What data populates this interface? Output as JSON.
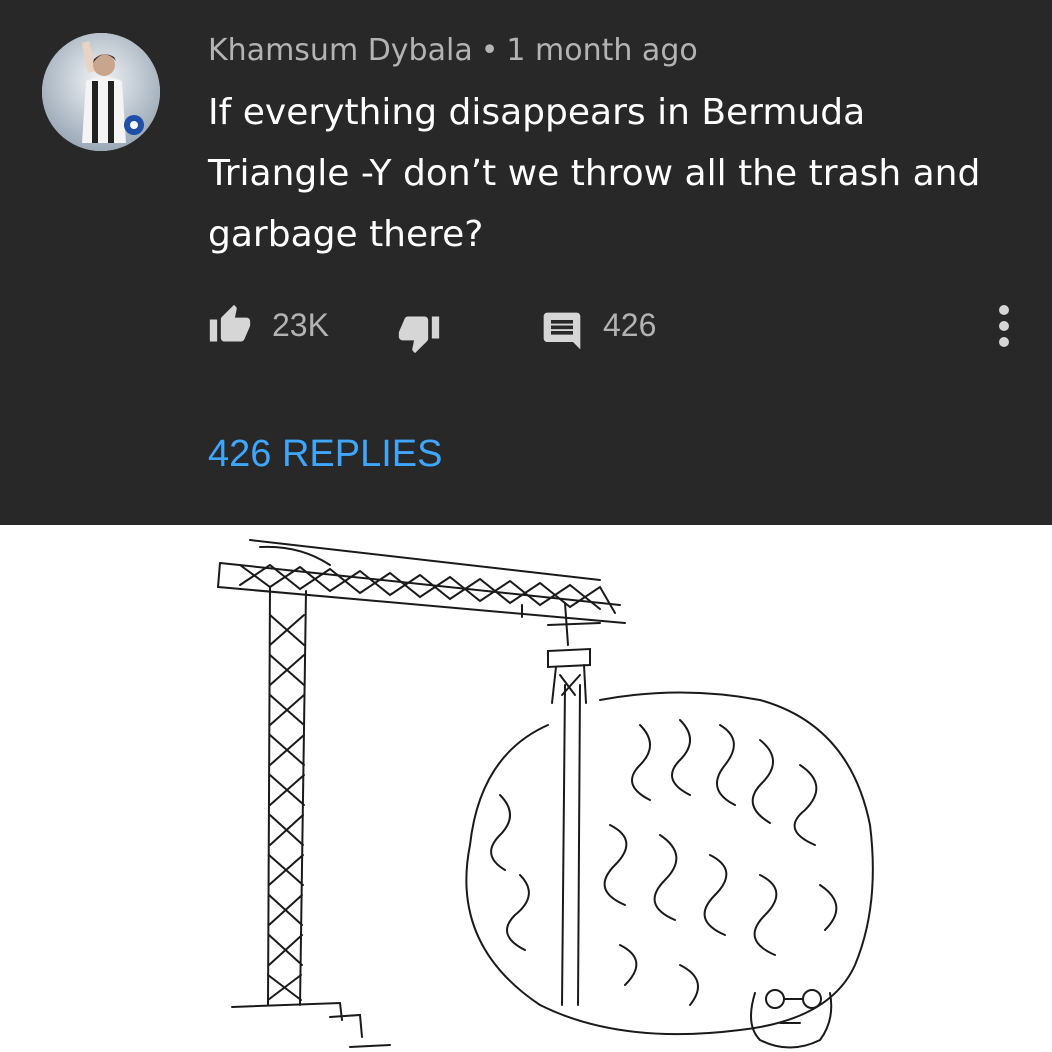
{
  "comment": {
    "author": "Khamsum Dybala",
    "separator": "•",
    "time": "1 month ago",
    "text": "If everything disappears in Bermuda Triangle -Y don’t we throw all the trash and garbage there?",
    "like_count": "23K",
    "reply_icon_count": "426",
    "replies_label": "426 REPLIES"
  },
  "icons": {
    "like": "thumbs-up-icon",
    "dislike": "thumbs-down-icon",
    "reply": "comment-icon",
    "more": "more-vertical-icon"
  },
  "colors": {
    "background": "#282828",
    "text": "#ffffff",
    "secondary_text": "#b3b3b3",
    "link": "#3ea6ff"
  }
}
